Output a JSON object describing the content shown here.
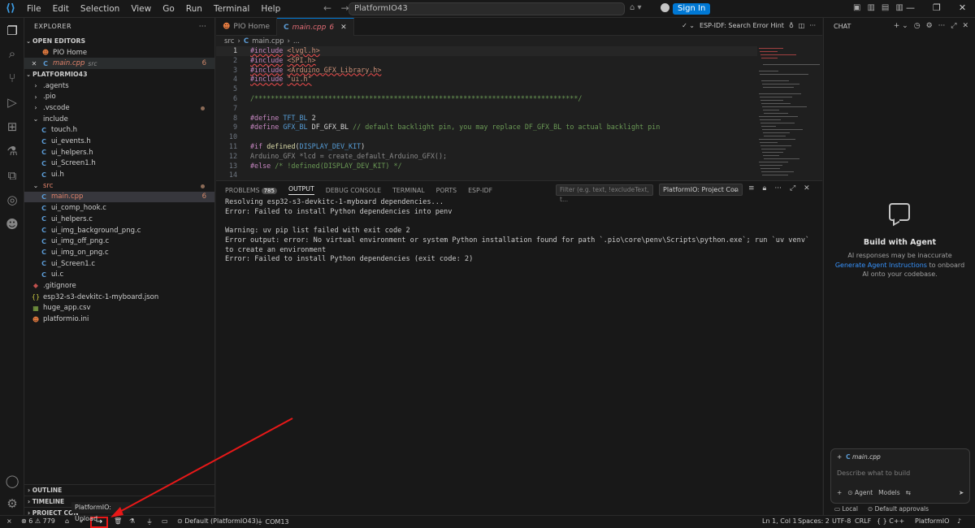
{
  "titlebar": {
    "menu": [
      "File",
      "Edit",
      "Selection",
      "View",
      "Go",
      "Run",
      "Terminal",
      "Help"
    ],
    "search_value": "PlatformIO43",
    "signin_label": "Sign In"
  },
  "sidebar": {
    "title": "EXPLORER",
    "open_editors_label": "OPEN EDITORS",
    "open_editors": [
      {
        "label": "PIO Home",
        "icon": "platformio-icon"
      },
      {
        "label": "main.cpp",
        "path": "src",
        "badge": "6",
        "icon": "cpp-file-icon"
      }
    ],
    "project_label": "PLATFORMIO43",
    "tree": [
      {
        "label": ".agents",
        "type": "folder",
        "depth": 0
      },
      {
        "label": ".pio",
        "type": "folder",
        "depth": 0
      },
      {
        "label": ".vscode",
        "type": "folder",
        "depth": 0,
        "dot": true
      },
      {
        "label": "include",
        "type": "folder-open",
        "depth": 0
      },
      {
        "label": "touch.h",
        "type": "c",
        "depth": 1
      },
      {
        "label": "ui_events.h",
        "type": "c",
        "depth": 1
      },
      {
        "label": "ui_helpers.h",
        "type": "c",
        "depth": 1
      },
      {
        "label": "ui_Screen1.h",
        "type": "c",
        "depth": 1
      },
      {
        "label": "ui.h",
        "type": "c",
        "depth": 1
      },
      {
        "label": "src",
        "type": "folder-open",
        "depth": 0,
        "dot": true,
        "error": true
      },
      {
        "label": "main.cpp",
        "type": "cpp",
        "depth": 1,
        "badge": "6",
        "error": true,
        "selected": true
      },
      {
        "label": "ui_comp_hook.c",
        "type": "c",
        "depth": 1
      },
      {
        "label": "ui_helpers.c",
        "type": "c",
        "depth": 1
      },
      {
        "label": "ui_img_background_png.c",
        "type": "c",
        "depth": 1
      },
      {
        "label": "ui_img_off_png.c",
        "type": "c",
        "depth": 1
      },
      {
        "label": "ui_img_on_png.c",
        "type": "c",
        "depth": 1
      },
      {
        "label": "ui_Screen1.c",
        "type": "c",
        "depth": 1
      },
      {
        "label": "ui.c",
        "type": "c",
        "depth": 1
      },
      {
        "label": ".gitignore",
        "type": "git",
        "depth": 0
      },
      {
        "label": "esp32-s3-devkitc-1-myboard.json",
        "type": "json",
        "depth": 0
      },
      {
        "label": "huge_app.csv",
        "type": "csv",
        "depth": 0
      },
      {
        "label": "platformio.ini",
        "type": "pio",
        "depth": 0
      }
    ],
    "outline_label": "OUTLINE",
    "timeline_label": "TIMELINE",
    "project_components_label": "PROJECT CON"
  },
  "editor": {
    "tabs": [
      {
        "label": "PIO Home",
        "active": false
      },
      {
        "label": "main.cpp",
        "badge": "6",
        "active": true
      }
    ],
    "tab_right_label": "ESP-IDF: Search Error Hint",
    "breadcrumb": [
      "src",
      "main.cpp",
      "..."
    ],
    "lines": [
      {
        "n": "1",
        "cur": true,
        "parts": [
          [
            "kw sq",
            "#include"
          ],
          [
            "plain",
            " "
          ],
          [
            "str sq",
            "<lvgl.h>"
          ]
        ]
      },
      {
        "n": "2",
        "parts": [
          [
            "kw sq",
            "#include"
          ],
          [
            "plain",
            " "
          ],
          [
            "str sq",
            "<SPI.h>"
          ]
        ]
      },
      {
        "n": "3",
        "parts": [
          [
            "kw sq",
            "#include"
          ],
          [
            "plain",
            " "
          ],
          [
            "str sq",
            "<Arduino_GFX_Library.h>"
          ]
        ]
      },
      {
        "n": "4",
        "parts": [
          [
            "kw sq",
            "#include"
          ],
          [
            "plain",
            " "
          ],
          [
            "str sq",
            "\"ui.h\""
          ]
        ]
      },
      {
        "n": "5",
        "parts": []
      },
      {
        "n": "6",
        "parts": [
          [
            "cm",
            "/*******************************************************************************/"
          ]
        ]
      },
      {
        "n": "7",
        "parts": []
      },
      {
        "n": "8",
        "parts": [
          [
            "kw",
            "#define"
          ],
          [
            "plain",
            " "
          ],
          [
            "mac",
            "TFT_BL"
          ],
          [
            "plain",
            " 2"
          ]
        ]
      },
      {
        "n": "9",
        "parts": [
          [
            "kw",
            "#define"
          ],
          [
            "plain",
            " "
          ],
          [
            "mac",
            "GFX_BL"
          ],
          [
            "plain",
            " DF_GFX_BL "
          ],
          [
            "cm",
            "// default backlight pin, you may replace DF_GFX_BL to actual backlight pin"
          ]
        ]
      },
      {
        "n": "10",
        "parts": []
      },
      {
        "n": "11",
        "parts": [
          [
            "kw",
            "#if"
          ],
          [
            "plain",
            " "
          ],
          [
            "fn",
            "defined"
          ],
          [
            "plain",
            "("
          ],
          [
            "mac",
            "DISPLAY_DEV_KIT"
          ],
          [
            "plain",
            ")"
          ]
        ]
      },
      {
        "n": "12",
        "parts": [
          [
            "cm2",
            "Arduino_GFX *lcd = create_default_Arduino_GFX();"
          ]
        ]
      },
      {
        "n": "13",
        "parts": [
          [
            "kw",
            "#else"
          ],
          [
            "plain",
            " "
          ],
          [
            "cm",
            "/* !defined(DISPLAY_DEV_KIT) */"
          ]
        ]
      },
      {
        "n": "14",
        "parts": []
      }
    ]
  },
  "panel": {
    "tabs": [
      {
        "label": "PROBLEMS",
        "count": "785"
      },
      {
        "label": "OUTPUT",
        "active": true
      },
      {
        "label": "DEBUG CONSOLE"
      },
      {
        "label": "TERMINAL"
      },
      {
        "label": "PORTS"
      },
      {
        "label": "ESP-IDF"
      }
    ],
    "filter_placeholder": "Filter (e.g. text, !excludeText, t...",
    "channel": "PlatformIO: Project Con",
    "output": "Resolving esp32-s3-devkitc-1-myboard dependencies...\nError: Failed to install Python dependencies into penv\n\nWarning: uv pip list failed with exit code 2\nError output: error: No virtual environment or system Python installation found for path `.pio\\core\\penv\\Scripts\\python.exe`; run `uv venv` to create an environment\nError: Failed to install Python dependencies (exit code: 2)"
  },
  "chat": {
    "title": "CHAT",
    "heading": "Build with Agent",
    "desc_before": "AI responses may be inaccurate",
    "desc_link": "Generate Agent Instructions",
    "desc_after": " to onboard AI onto your codebase.",
    "context_file": "main.cpp",
    "input_placeholder": "Describe what to build",
    "mode_label": "Agent",
    "models_label": "Models",
    "local_label": "Local",
    "approvals_label": "Default approvals"
  },
  "statusbar": {
    "errors": "6",
    "warnings": "779",
    "env": "Default (PlatformIO43)",
    "port": "COM13",
    "position": "Ln 1, Col 1",
    "spaces": "Spaces: 2",
    "encoding": "UTF-8",
    "eol": "CRLF",
    "language": "C++",
    "platformio": "PlatformIO",
    "tooltip": "PlatformIO: Upload"
  },
  "colors": {
    "accent": "#0078d4",
    "annotation_red": "#e81818",
    "error": "#e0826a"
  }
}
